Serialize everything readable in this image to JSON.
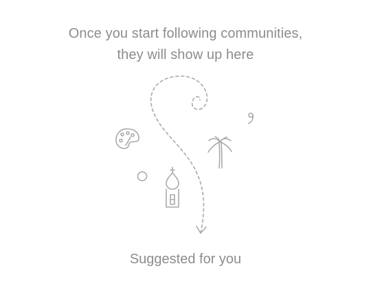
{
  "empty_state": {
    "line1": "Once you start following communities,",
    "line2": "they will show up here"
  },
  "illustration": {
    "stroke_color": "#a9a9a9",
    "icons": [
      "dashed-path-arrow-icon",
      "palette-icon",
      "palm-tree-icon",
      "onion-dome-tower-icon",
      "comma-icon",
      "circle-icon"
    ]
  },
  "suggested": {
    "label": "Suggested for you"
  }
}
